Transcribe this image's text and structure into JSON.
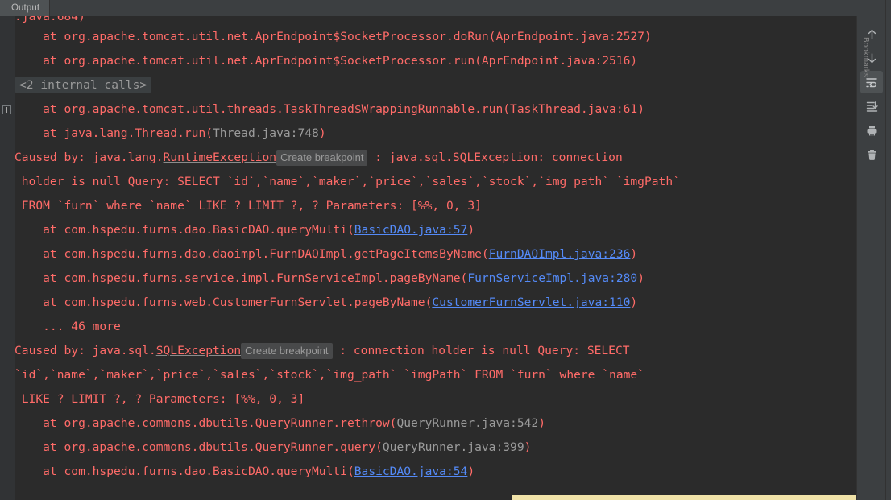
{
  "window": {
    "tabs": [
      {
        "label": "Output",
        "active": true,
        "name": "tab-output"
      }
    ],
    "right_edge_label": "Bookmarks"
  },
  "toolbar": {
    "buttons": [
      {
        "name": "up-arrow-icon",
        "label": "Up",
        "icon": "arrow-up",
        "active": false
      },
      {
        "name": "down-arrow-icon",
        "label": "Down",
        "icon": "arrow-down",
        "active": false
      },
      {
        "name": "soft-wrap-icon",
        "label": "Soft-Wrap",
        "icon": "soft-wrap",
        "active": true
      },
      {
        "name": "scroll-to-end-icon",
        "label": "Scroll to End",
        "icon": "scroll-to-end",
        "active": false
      },
      {
        "name": "print-icon",
        "label": "Print",
        "icon": "print",
        "active": false
      },
      {
        "name": "trash-icon",
        "label": "Clear All",
        "icon": "trash",
        "active": false
      }
    ]
  },
  "colors": {
    "console_bg": "#2b2b2b",
    "panel_bg": "#3c3f41",
    "gutter_bg": "#313335",
    "error_text": "#ff6b68",
    "link_project": "#548af7",
    "link_library": "#9b9b9b",
    "breakpoint_chip_bg": "#48494a",
    "fold_chip_bg": "#3b3f41",
    "progress_bar": "#f0e2a8",
    "scrollbar_thumb": "#5c5f61"
  },
  "console": {
    "fold_marker": "<2 internal calls>",
    "lines": [
      {
        "id": "l0",
        "type": "clipped",
        "text": ".java:684)"
      },
      {
        "id": "l1",
        "type": "stack",
        "pre": "    at org.apache.tomcat.util.net.AprEndpoint$SocketProcessor.doRun(",
        "link": "AprEndpoint.java:2527",
        "link_kind": "none",
        "post": ")"
      },
      {
        "id": "l2",
        "type": "stack",
        "pre": "    at org.apache.tomcat.util.net.AprEndpoint$SocketProcessor.run(",
        "link": "AprEndpoint.java:2516",
        "link_kind": "none",
        "post": ")"
      },
      {
        "id": "l3",
        "type": "fold",
        "text": "<2 internal calls>"
      },
      {
        "id": "l4",
        "type": "stack",
        "pre": "    at org.apache.tomcat.util.threads.TaskThread$WrappingRunnable.run(",
        "link": "TaskThread.java:61",
        "link_kind": "none",
        "post": ")"
      },
      {
        "id": "l5",
        "type": "stack",
        "pre": "    at java.lang.Thread.run(",
        "link": "Thread.java:748",
        "link_kind": "library",
        "post": ")"
      },
      {
        "id": "l6",
        "type": "caused_by",
        "pre": "Caused by: java.lang.",
        "exception": "RuntimeException",
        "chip": "Create breakpoint",
        "post": " : java.sql.SQLException: connection"
      },
      {
        "id": "l7",
        "type": "wrap",
        "text": " holder is null Query: SELECT `id`,`name`,`maker`,`price`,`sales`,`stock`,`img_path` `imgPath`"
      },
      {
        "id": "l8",
        "type": "wrap",
        "text": " FROM `furn` where `name` LIKE ? LIMIT ?, ? Parameters: [%%, 0, 3]"
      },
      {
        "id": "l9",
        "type": "stack",
        "pre": "    at com.hspedu.furns.dao.BasicDAO.queryMulti(",
        "link": "BasicDAO.java:57",
        "link_kind": "project",
        "post": ")"
      },
      {
        "id": "l10",
        "type": "stack",
        "pre": "    at com.hspedu.furns.dao.daoimpl.FurnDAOImpl.getPageItemsByName(",
        "link": "FurnDAOImpl.java:236",
        "link_kind": "project",
        "post": ")"
      },
      {
        "id": "l11",
        "type": "stack",
        "pre": "    at com.hspedu.furns.service.impl.FurnServiceImpl.pageByName(",
        "link": "FurnServiceImpl.java:280",
        "link_kind": "project",
        "post": ")"
      },
      {
        "id": "l12",
        "type": "stack",
        "pre": "    at com.hspedu.furns.web.CustomerFurnServlet.pageByName(",
        "link": "CustomerFurnServlet.java:110",
        "link_kind": "project",
        "post": ")"
      },
      {
        "id": "l13",
        "type": "more",
        "text": "    ... 46 more"
      },
      {
        "id": "l14",
        "type": "caused_by",
        "pre": "Caused by: java.sql.",
        "exception": "SQLException",
        "chip": "Create breakpoint",
        "post": " : connection holder is null Query: SELECT"
      },
      {
        "id": "l15",
        "type": "wrap",
        "text": "`id`,`name`,`maker`,`price`,`sales`,`stock`,`img_path` `imgPath` FROM `furn` where `name`"
      },
      {
        "id": "l16",
        "type": "wrap",
        "text": " LIKE ? LIMIT ?, ? Parameters: [%%, 0, 3]"
      },
      {
        "id": "l17",
        "type": "stack",
        "pre": "    at org.apache.commons.dbutils.QueryRunner.rethrow(",
        "link": "QueryRunner.java:542",
        "link_kind": "library",
        "post": ")"
      },
      {
        "id": "l18",
        "type": "stack",
        "pre": "    at org.apache.commons.dbutils.QueryRunner.query(",
        "link": "QueryRunner.java:399",
        "link_kind": "library",
        "post": ")"
      },
      {
        "id": "l19",
        "type": "stack",
        "pre": "    at com.hspedu.furns.dao.BasicDAO.queryMulti(",
        "link": "BasicDAO.java:54",
        "link_kind": "project",
        "post": ")"
      }
    ]
  }
}
